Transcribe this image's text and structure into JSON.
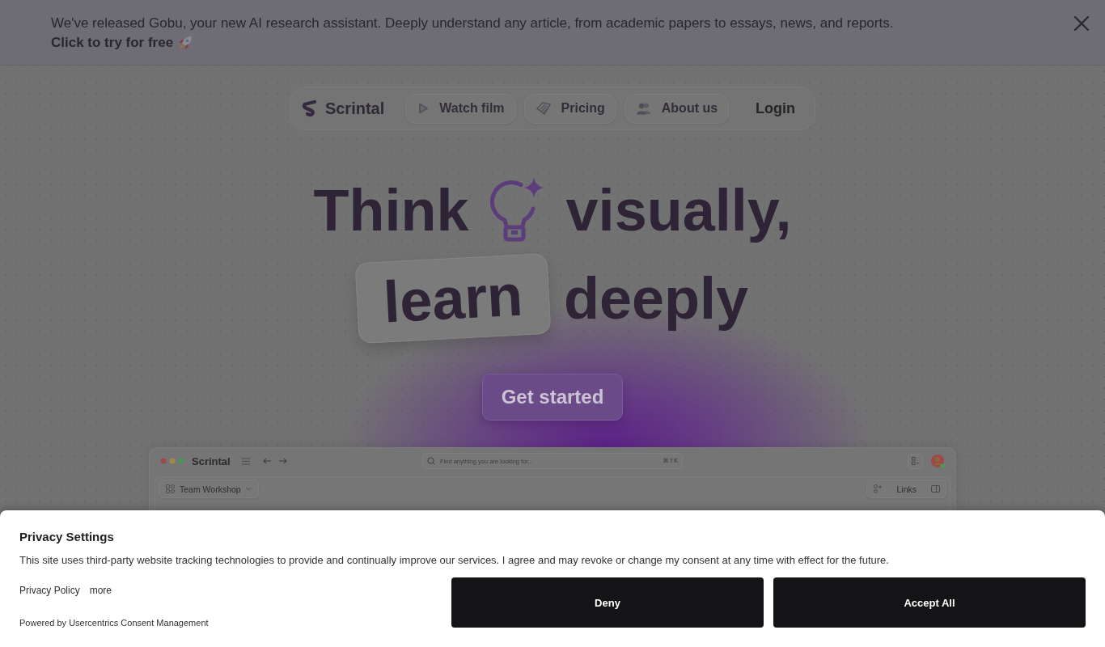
{
  "announcement": {
    "text": "We've released Gobu, your new AI research assistant. Deeply understand any article, from academic papers to essays, news, and reports.",
    "link": "Click to try for free"
  },
  "nav": {
    "brand": "Scrintal",
    "items": [
      {
        "label": "Watch film",
        "kind": "pill"
      },
      {
        "label": "Pricing",
        "kind": "pill"
      },
      {
        "label": "About us",
        "kind": "pill"
      },
      {
        "label": "Login",
        "kind": "plain"
      }
    ]
  },
  "hero": {
    "title_start": "Think",
    "title_end": "visually,",
    "highlight": "learn",
    "title_tail": "deeply",
    "cta": "Get started"
  },
  "app_preview": {
    "brand": "Scrintal",
    "search": {
      "placeholder": "Find anything you are looking for...",
      "shortcut": "⌘⇧K"
    },
    "workspace": "Team Workshop",
    "links": "Links"
  },
  "consent": {
    "title": "Privacy Settings",
    "body": "This site uses third-party website tracking technologies to provide and continually improve our services. I agree and may revoke or change my consent at any time with effect for the future.",
    "links": [
      "Privacy Policy",
      "more"
    ],
    "footer": "Powered by Usercentrics Consent Management",
    "buttons": [
      "Deny",
      "Accept All"
    ]
  }
}
